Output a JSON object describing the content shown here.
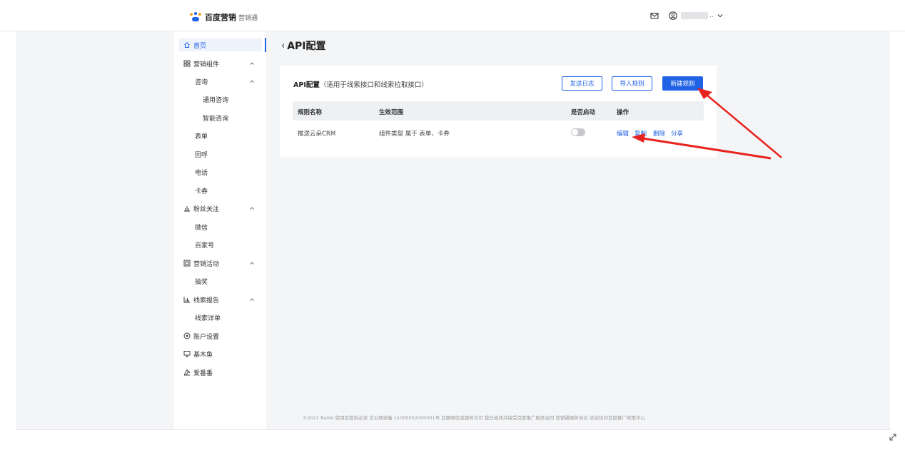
{
  "header": {
    "logo_brand": "百度营销",
    "logo_product": "营销通",
    "user_name_suffix": "..",
    "icons": [
      "mail-icon",
      "user-circle-icon",
      "chevron-down-icon"
    ]
  },
  "sidebar": {
    "items": [
      {
        "label": "首页",
        "icon": "home-icon",
        "active": true
      },
      {
        "label": "营销组件",
        "icon": "grid-icon",
        "expanded": true
      },
      {
        "label": "咨询",
        "expanded": true
      },
      {
        "label": "通用咨询"
      },
      {
        "label": "智能咨询"
      },
      {
        "label": "表单"
      },
      {
        "label": "回呼"
      },
      {
        "label": "电话"
      },
      {
        "label": "卡券"
      },
      {
        "label": "粉丝关注",
        "icon": "fans-icon",
        "expanded": true
      },
      {
        "label": "微信"
      },
      {
        "label": "百家号"
      },
      {
        "label": "营销活动",
        "icon": "activity-icon",
        "expanded": true
      },
      {
        "label": "抽奖"
      },
      {
        "label": "线索报告",
        "icon": "bar-chart-icon",
        "expanded": true
      },
      {
        "label": "线索详单"
      },
      {
        "label": "账户设置",
        "icon": "settings-circle-icon"
      },
      {
        "label": "基木鱼",
        "icon": "monitor-icon"
      },
      {
        "label": "爱番番",
        "icon": "aifanfan-icon"
      }
    ]
  },
  "page": {
    "back_symbol": "‹",
    "title": "API配置"
  },
  "card": {
    "title_bold": "API配置",
    "title_sub": "（适用于线索接口和线索拉取接口）",
    "buttons": {
      "send_log": "发送日志",
      "import_rule": "导入规则",
      "new_rule": "新建规则"
    },
    "table": {
      "headers": [
        "规则名称",
        "生效范围",
        "是否启动",
        "操作"
      ],
      "rows": [
        {
          "name": "推送云朵CRM",
          "scope": "组件类型 属于 表单、卡券",
          "enabled": false,
          "actions": [
            "编辑",
            "复制",
            "删除",
            "分享"
          ]
        }
      ]
    }
  },
  "footer": {
    "text": "©2021 Baidu 使用百度前必读 京公网安备 11000002000001号 互联网信息服务许可 我已阅读并接受百度推广服务合同 营销通服务协议 欢迎访问百度推广政策中心"
  },
  "colors": {
    "primary": "#1f62e6",
    "annotation_arrow": "#e8231f",
    "background_grey": "#f4f5f7"
  }
}
